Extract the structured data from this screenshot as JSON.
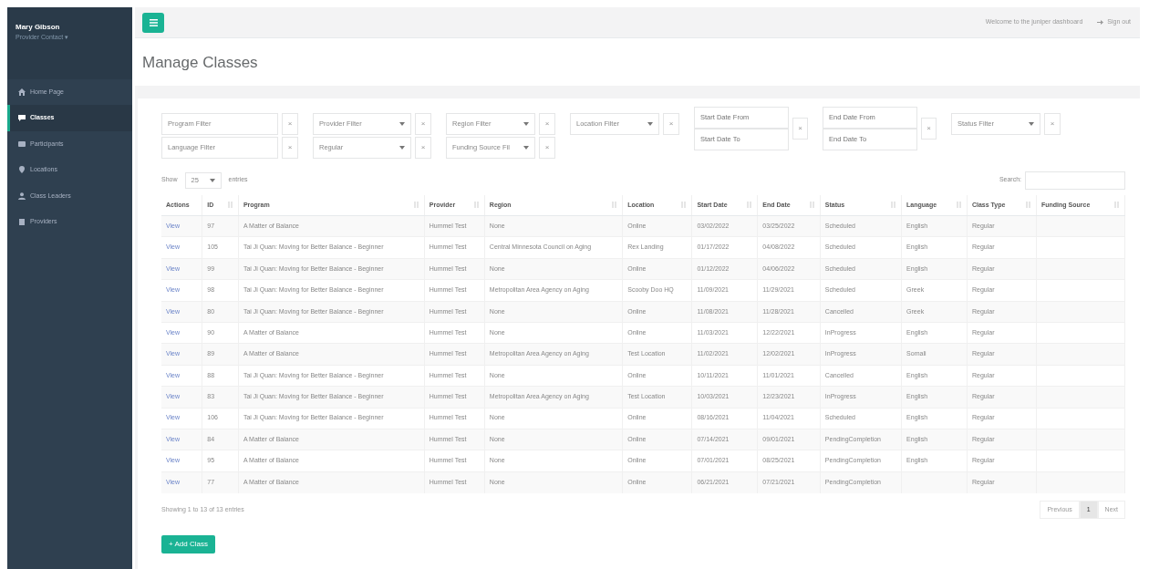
{
  "sidebar": {
    "user_name": "Mary Gibson",
    "user_role": "Provider Contact ▾",
    "items": [
      {
        "label": "Home Page",
        "selected": false
      },
      {
        "label": "Classes",
        "selected": true
      },
      {
        "label": "Participants",
        "selected": false
      },
      {
        "label": "Locations",
        "selected": false
      },
      {
        "label": "Class Leaders",
        "selected": false
      },
      {
        "label": "Providers",
        "selected": false
      }
    ]
  },
  "top_bar": {
    "welcome": "Welcome to the juniper dashboard",
    "sign_out": "Sign out"
  },
  "page_title": "Manage Classes",
  "filters": [
    {
      "kind": "multiselect",
      "label": "Program Filter",
      "clear": "×"
    },
    {
      "kind": "select",
      "label": "Provider Filter",
      "clear": "×"
    },
    {
      "kind": "select",
      "label": "Region Filter",
      "clear": "×"
    },
    {
      "kind": "select",
      "label": "Location Filter",
      "clear": "×"
    },
    {
      "kind": "daterange",
      "from": {
        "placeholder": "Start Date From"
      },
      "to": {
        "placeholder": "Start Date To"
      },
      "clear": "×"
    },
    {
      "kind": "daterange",
      "from": {
        "placeholder": "End Date From"
      },
      "to": {
        "placeholder": "End Date To"
      },
      "clear": "×"
    },
    {
      "kind": "select",
      "label": "Status Filter",
      "clear": "×"
    },
    {
      "kind": "multiselect",
      "label": "Language Filter",
      "clear": "×"
    },
    {
      "kind": "select",
      "label": "Regular",
      "clear": "×"
    },
    {
      "kind": "select",
      "label": "Funding Source Fil",
      "clear": "×"
    }
  ],
  "entries": {
    "show": "Show",
    "value": "25",
    "suffix": "entries"
  },
  "search": {
    "label": "Search:"
  },
  "table": {
    "columns": [
      "Actions",
      "ID",
      "Program",
      "Provider",
      "Region",
      "Location",
      "Start Date",
      "End Date",
      "Status",
      "Language",
      "Class Type",
      "Funding Source"
    ],
    "rows": [
      [
        "View",
        "97",
        "A Matter of Balance",
        "Hummel Test",
        "None",
        "Online",
        "03/02/2022",
        "03/25/2022",
        "Scheduled",
        "English",
        "Regular",
        ""
      ],
      [
        "View",
        "105",
        "Tai Ji Quan: Moving for Better Balance - Beginner",
        "Hummel Test",
        "Central Minnesota Council on Aging",
        "Rex Landing",
        "01/17/2022",
        "04/08/2022",
        "Scheduled",
        "English",
        "Regular",
        ""
      ],
      [
        "View",
        "99",
        "Tai Ji Quan: Moving for Better Balance - Beginner",
        "Hummel Test",
        "None",
        "Online",
        "01/12/2022",
        "04/06/2022",
        "Scheduled",
        "English",
        "Regular",
        ""
      ],
      [
        "View",
        "98",
        "Tai Ji Quan: Moving for Better Balance - Beginner",
        "Hummel Test",
        "Metropolitan Area Agency on Aging",
        "Scooby Doo HQ",
        "11/09/2021",
        "11/29/2021",
        "Scheduled",
        "Greek",
        "Regular",
        ""
      ],
      [
        "View",
        "80",
        "Tai Ji Quan: Moving for Better Balance - Beginner",
        "Hummel Test",
        "None",
        "Online",
        "11/08/2021",
        "11/28/2021",
        "Cancelled",
        "Greek",
        "Regular",
        ""
      ],
      [
        "View",
        "90",
        "A Matter of Balance",
        "Hummel Test",
        "None",
        "Online",
        "11/03/2021",
        "12/22/2021",
        "InProgress",
        "English",
        "Regular",
        ""
      ],
      [
        "View",
        "89",
        "A Matter of Balance",
        "Hummel Test",
        "Metropolitan Area Agency on Aging",
        "Test Location",
        "11/02/2021",
        "12/02/2021",
        "InProgress",
        "Somali",
        "Regular",
        ""
      ],
      [
        "View",
        "88",
        "Tai Ji Quan: Moving for Better Balance - Beginner",
        "Hummel Test",
        "None",
        "Online",
        "10/11/2021",
        "11/01/2021",
        "Cancelled",
        "English",
        "Regular",
        ""
      ],
      [
        "View",
        "83",
        "Tai Ji Quan: Moving for Better Balance - Beginner",
        "Hummel Test",
        "Metropolitan Area Agency on Aging",
        "Test Location",
        "10/03/2021",
        "12/23/2021",
        "InProgress",
        "English",
        "Regular",
        ""
      ],
      [
        "View",
        "106",
        "Tai Ji Quan: Moving for Better Balance - Beginner",
        "Hummel Test",
        "None",
        "Online",
        "08/16/2021",
        "11/04/2021",
        "Scheduled",
        "English",
        "Regular",
        ""
      ],
      [
        "View",
        "84",
        "A Matter of Balance",
        "Hummel Test",
        "None",
        "Online",
        "07/14/2021",
        "09/01/2021",
        "PendingCompletion",
        "English",
        "Regular",
        ""
      ],
      [
        "View",
        "95",
        "A Matter of Balance",
        "Hummel Test",
        "None",
        "Online",
        "07/01/2021",
        "08/25/2021",
        "PendingCompletion",
        "English",
        "Regular",
        ""
      ],
      [
        "View",
        "77",
        "A Matter of Balance",
        "Hummel Test",
        "None",
        "Online",
        "06/21/2021",
        "07/21/2021",
        "PendingCompletion",
        "",
        "Regular",
        ""
      ]
    ]
  },
  "info": "Showing 1 to 13 of 13 entries",
  "pagination": [
    {
      "label": "Previous",
      "selected": false
    },
    {
      "label": "1",
      "selected": true
    },
    {
      "label": "Next",
      "selected": false
    }
  ],
  "add_button": "+ Add Class"
}
